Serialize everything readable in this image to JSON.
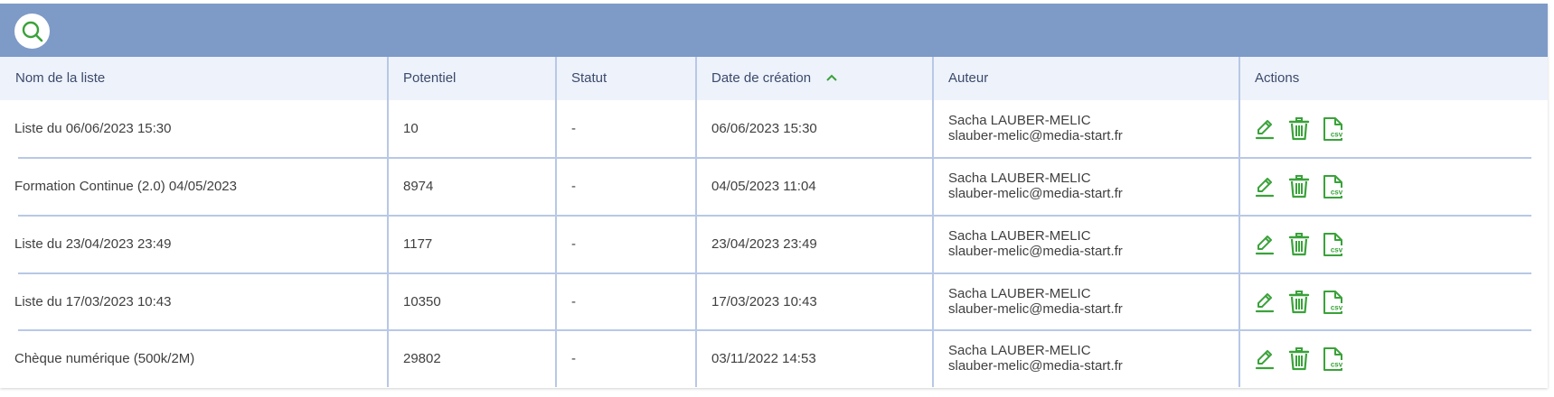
{
  "colors": {
    "topbar": "#7e9ac7",
    "header_bg": "#eef2fb",
    "divider": "#b8c8e6",
    "accent_green": "#3aa23a",
    "text": "#3f3f3f",
    "header_text": "#3b4a6b"
  },
  "toolbar": {
    "search_icon": "search-icon"
  },
  "table": {
    "columns": [
      {
        "label": "Nom de la liste"
      },
      {
        "label": "Potentiel"
      },
      {
        "label": "Statut"
      },
      {
        "label": "Date de création",
        "sort": "ascending"
      },
      {
        "label": "Auteur"
      },
      {
        "label": "Actions"
      }
    ],
    "rows": [
      {
        "name": "Liste du 06/06/2023 15:30",
        "potentiel": "10",
        "statut": "-",
        "date": "06/06/2023 15:30",
        "author_name": "Sacha LAUBER-MELIC",
        "author_email": "slauber-melic@media-start.fr"
      },
      {
        "name": "Formation Continue (2.0) 04/05/2023",
        "potentiel": "8974",
        "statut": "-",
        "date": "04/05/2023 11:04",
        "author_name": "Sacha LAUBER-MELIC",
        "author_email": "slauber-melic@media-start.fr"
      },
      {
        "name": "Liste du 23/04/2023 23:49",
        "potentiel": "1177",
        "statut": "-",
        "date": "23/04/2023 23:49",
        "author_name": "Sacha LAUBER-MELIC",
        "author_email": "slauber-melic@media-start.fr"
      },
      {
        "name": "Liste du 17/03/2023 10:43",
        "potentiel": "10350",
        "statut": "-",
        "date": "17/03/2023 10:43",
        "author_name": "Sacha LAUBER-MELIC",
        "author_email": "slauber-melic@media-start.fr"
      },
      {
        "name": "Chèque numérique (500k/2M)",
        "potentiel": "29802",
        "statut": "-",
        "date": "03/11/2022 14:53",
        "author_name": "Sacha LAUBER-MELIC",
        "author_email": "slauber-melic@media-start.fr"
      }
    ],
    "actions": [
      {
        "icon": "edit-pencil-icon"
      },
      {
        "icon": "trash-icon"
      },
      {
        "icon": "csv-export-icon",
        "badge": "csv"
      }
    ]
  }
}
